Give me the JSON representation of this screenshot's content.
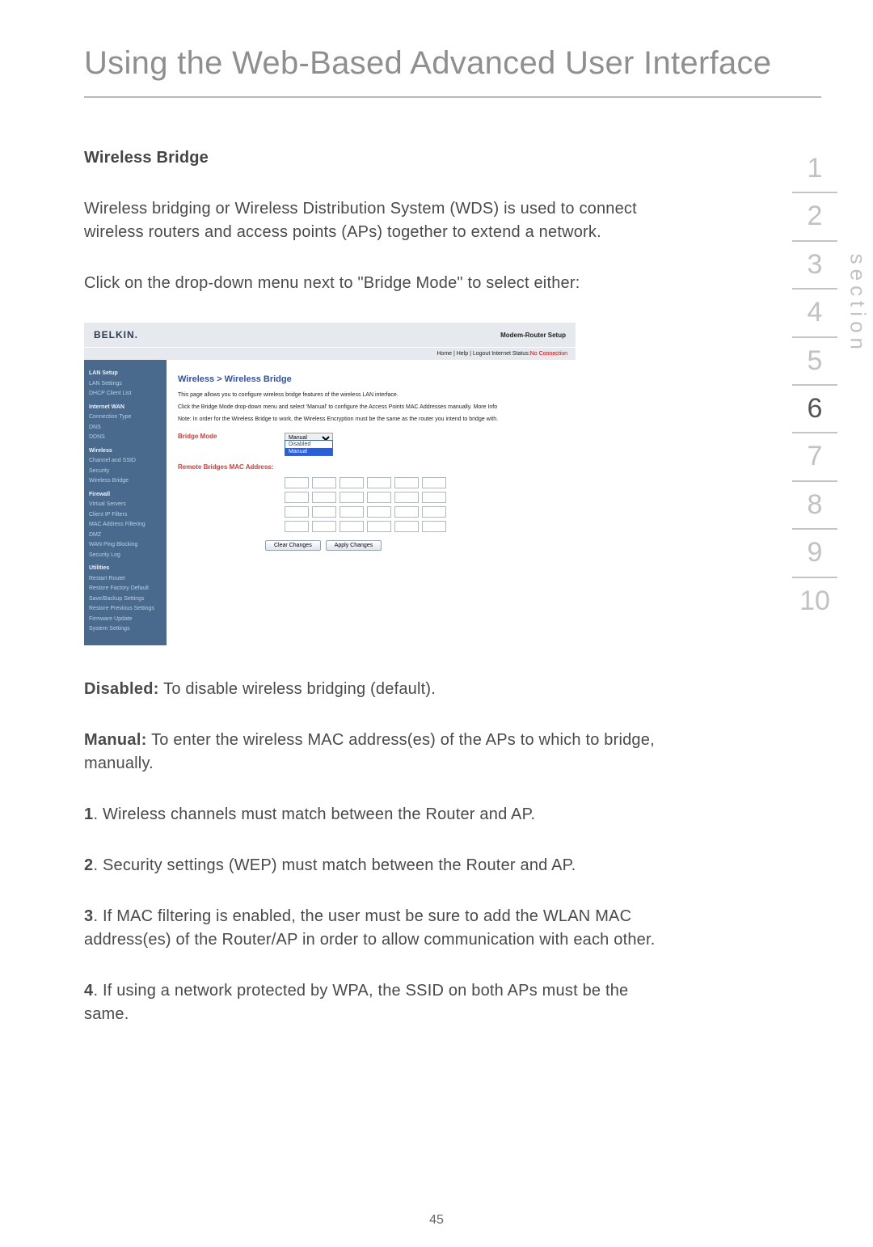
{
  "title": "Using the Web-Based Advanced User Interface",
  "page_number": "45",
  "side_label": "section",
  "sections": [
    "1",
    "2",
    "3",
    "4",
    "5",
    "6",
    "7",
    "8",
    "9",
    "10"
  ],
  "active_section_index": 5,
  "content": {
    "heading": "Wireless Bridge",
    "intro": "Wireless bridging or Wireless Distribution System (WDS) is used to connect wireless routers and access points (APs) together to extend a network.",
    "instruction": "Click on the drop-down menu next to \"Bridge Mode\" to select either:",
    "disabled_label": "Disabled:",
    "disabled_text": " To disable wireless bridging (default).",
    "manual_label": "Manual:",
    "manual_text": " To enter the wireless MAC address(es) of the APs to which to bridge, manually.",
    "steps": [
      {
        "n": "1",
        "t": ". Wireless channels must match between the Router and AP."
      },
      {
        "n": "2",
        "t": ". Security settings (WEP) must match between the Router and AP."
      },
      {
        "n": "3",
        "t": ". If MAC filtering is enabled, the user must be sure to add the WLAN MAC address(es) of the Router/AP in order to allow communication with each other."
      },
      {
        "n": "4",
        "t": ". If using a network protected by WPA, the SSID on both APs must be the same."
      }
    ]
  },
  "screenshot": {
    "logo": "BELKIN.",
    "router_title": "Modem-Router Setup",
    "status_left": "Home | Help | Logout   Internet Status:",
    "status_right": "No Connection",
    "sidebar": [
      {
        "grp": "LAN Setup",
        "items": [
          "LAN Settings",
          "DHCP Client List"
        ]
      },
      {
        "grp": "Internet WAN",
        "items": [
          "Connection Type",
          "DNS",
          "DDNS"
        ]
      },
      {
        "grp": "Wireless",
        "items": [
          "Channel and SSID",
          "Security",
          "Wireless Bridge"
        ]
      },
      {
        "grp": "Firewall",
        "items": [
          "Virtual Servers",
          "Client IP Filters",
          "MAC Address Filtering",
          "DMZ",
          "WAN Ping Blocking",
          "Security Log"
        ]
      },
      {
        "grp": "Utilities",
        "items": [
          "Restart Router",
          "Restore Factory Default",
          "Save/Backup Settings",
          "Restore Previous Settings",
          "Firmware Update",
          "System Settings"
        ]
      }
    ],
    "breadcrumb": "Wireless > Wireless Bridge",
    "desc1": "This page allows you to configure wireless bridge features of the wireless LAN interface.",
    "desc2a": "Click the Bridge Mode drop-down menu and select 'Manual' to configure the Access Points MAC Addresses manually. ",
    "desc2_link": "More Info",
    "note": "Note: In order for the Wireless Bridge to work, the Wireless Encryption must be the same as the router you intend to bridge with.",
    "bridge_label": "Bridge Mode",
    "bridge_value": "Manual",
    "bridge_options": [
      "Disabled",
      "Manual"
    ],
    "mac_label": "Remote Bridges MAC Address:",
    "btn_clear": "Clear Changes",
    "btn_apply": "Apply Changes"
  }
}
